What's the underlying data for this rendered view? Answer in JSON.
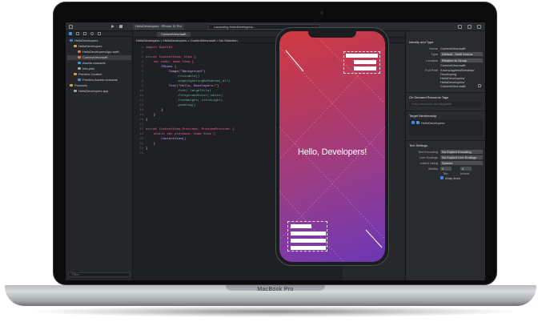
{
  "laptop": {
    "brand": "MacBook Pro"
  },
  "toolbar": {
    "scheme": "HelloDevelopers",
    "device": "iPhone 11 Pro",
    "status": "Launching HelloDevelopers..."
  },
  "editor": {
    "tab": "ContentView.swift",
    "jumpbar": "HelloDevelopers  >  HelloDevelopers  >  ContentView.swift  >  No Selection",
    "line_numbers": [
      "1",
      "2",
      "3",
      "4",
      "5",
      "6",
      "7",
      "8",
      "9",
      "10",
      "11",
      "12",
      "13",
      "14",
      "15",
      "16",
      "17",
      "18",
      "19",
      "20",
      "21",
      "22",
      "23"
    ],
    "lines": [
      "import SwiftUI",
      "",
      "struct ContentView: View {",
      "    var body: some View {",
      "        ZStack {",
      "            Image(\"Background\")",
      "                .resizable()",
      "                .edgesIgnoringSafeArea(.all)",
      "            Text(\"Hello, Developers!\")",
      "                .font(.largeTitle)",
      "                .foregroundColor(.white)",
      "                .fontWeight(.ultraLight)",
      "                .padding()",
      "        }",
      "    }",
      "}",
      "",
      "struct ContentView_Previews: PreviewProvider {",
      "    static var previews: some View {",
      "        ContentView()",
      "    }",
      "}",
      ""
    ]
  },
  "navigator": {
    "items": [
      {
        "label": "HelloDevelopers",
        "indent": 0,
        "color": "#3a7bd5"
      },
      {
        "label": "HelloDevelopers",
        "indent": 1,
        "color": "#c7a34a"
      },
      {
        "label": "HelloDevelopersApp.swift",
        "indent": 2,
        "color": "#e8734a"
      },
      {
        "label": "ContentView.swift",
        "indent": 2,
        "color": "#e8734a"
      },
      {
        "label": "Assets.xcassets",
        "indent": 2,
        "color": "#4a90d9"
      },
      {
        "label": "Info.plist",
        "indent": 2,
        "color": "#9aa0a6"
      },
      {
        "label": "Preview Content",
        "indent": 1,
        "color": "#c7a34a"
      },
      {
        "label": "Preview Assets.xcassets",
        "indent": 2,
        "color": "#4a90d9"
      },
      {
        "label": "Products",
        "indent": 0,
        "color": "#c7a34a"
      },
      {
        "label": "HelloDevelopers.app",
        "indent": 1,
        "color": "#9aa0a6"
      }
    ],
    "filter_placeholder": "Filter"
  },
  "inspector": {
    "identity_title": "Identity and Type",
    "name_label": "Name",
    "name_value": "ContentView.swift",
    "type_label": "Type",
    "type_value": "Default - Swift Source",
    "location_label": "Location",
    "location_value": "Relative to Group",
    "location_file": "ContentView.swift",
    "fullpath_label": "Full Path",
    "fullpath_lines": [
      "/Users/appleid/Desktop/",
      "Developing",
      "HelloDevelopers/",
      "HelloDevelopers/",
      "ContentView.swift"
    ],
    "odr_title": "On Demand Resource Tags",
    "odr_placeholder": "Only resources are taggable",
    "target_title": "Target Membership",
    "target_item": "HelloDevelopers",
    "text_title": "Text Settings",
    "encoding_label": "Text Encoding",
    "encoding_value": "No Explicit Encoding",
    "endings_label": "Line Endings",
    "endings_value": "No Explicit Line Endings",
    "indent_label": "Indent Using",
    "indent_value": "Spaces",
    "widths_label": "Widths",
    "tab_value": "4",
    "indent_num": "4",
    "tab_caption": "Tab",
    "indent_caption": "Indent",
    "wrap_label": "Wrap lines"
  },
  "preview": {
    "title": "Hello, Developers!"
  }
}
